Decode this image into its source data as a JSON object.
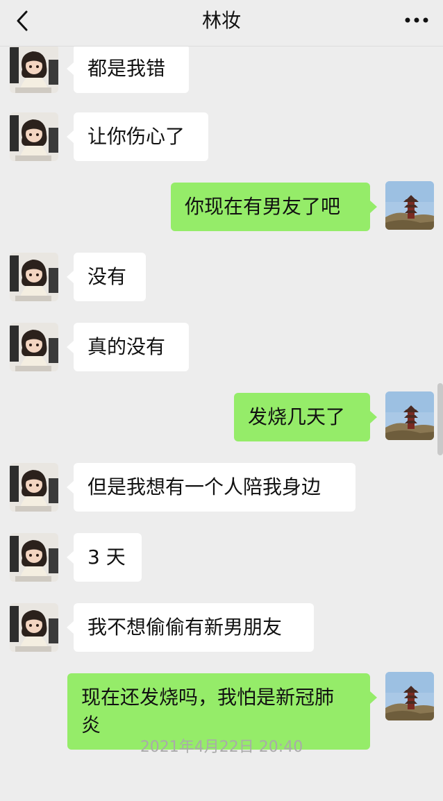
{
  "header": {
    "title": "林妆",
    "back_icon": "chevron-left-icon",
    "more_icon": "more-dots-icon"
  },
  "messages": [
    {
      "side": "left",
      "text": "都是我错"
    },
    {
      "side": "left",
      "text": "让你伤心了"
    },
    {
      "side": "right",
      "text": "你现在有男友了吧"
    },
    {
      "side": "left",
      "text": "没有"
    },
    {
      "side": "left",
      "text": "真的没有"
    },
    {
      "side": "right",
      "text": "发烧几天了"
    },
    {
      "side": "left",
      "text": "但是我想有一个人陪我身边"
    },
    {
      "side": "left",
      "text": "3 天"
    },
    {
      "side": "left",
      "text": "我不想偷偷有新男朋友"
    },
    {
      "side": "right",
      "text": "现在还发烧吗，我怕是新冠肺\n炎"
    }
  ],
  "timestamp": "2021年4月22日 20:40",
  "colors": {
    "background": "#ededed",
    "incoming_bubble": "#ffffff",
    "outgoing_bubble": "#95ec69"
  }
}
